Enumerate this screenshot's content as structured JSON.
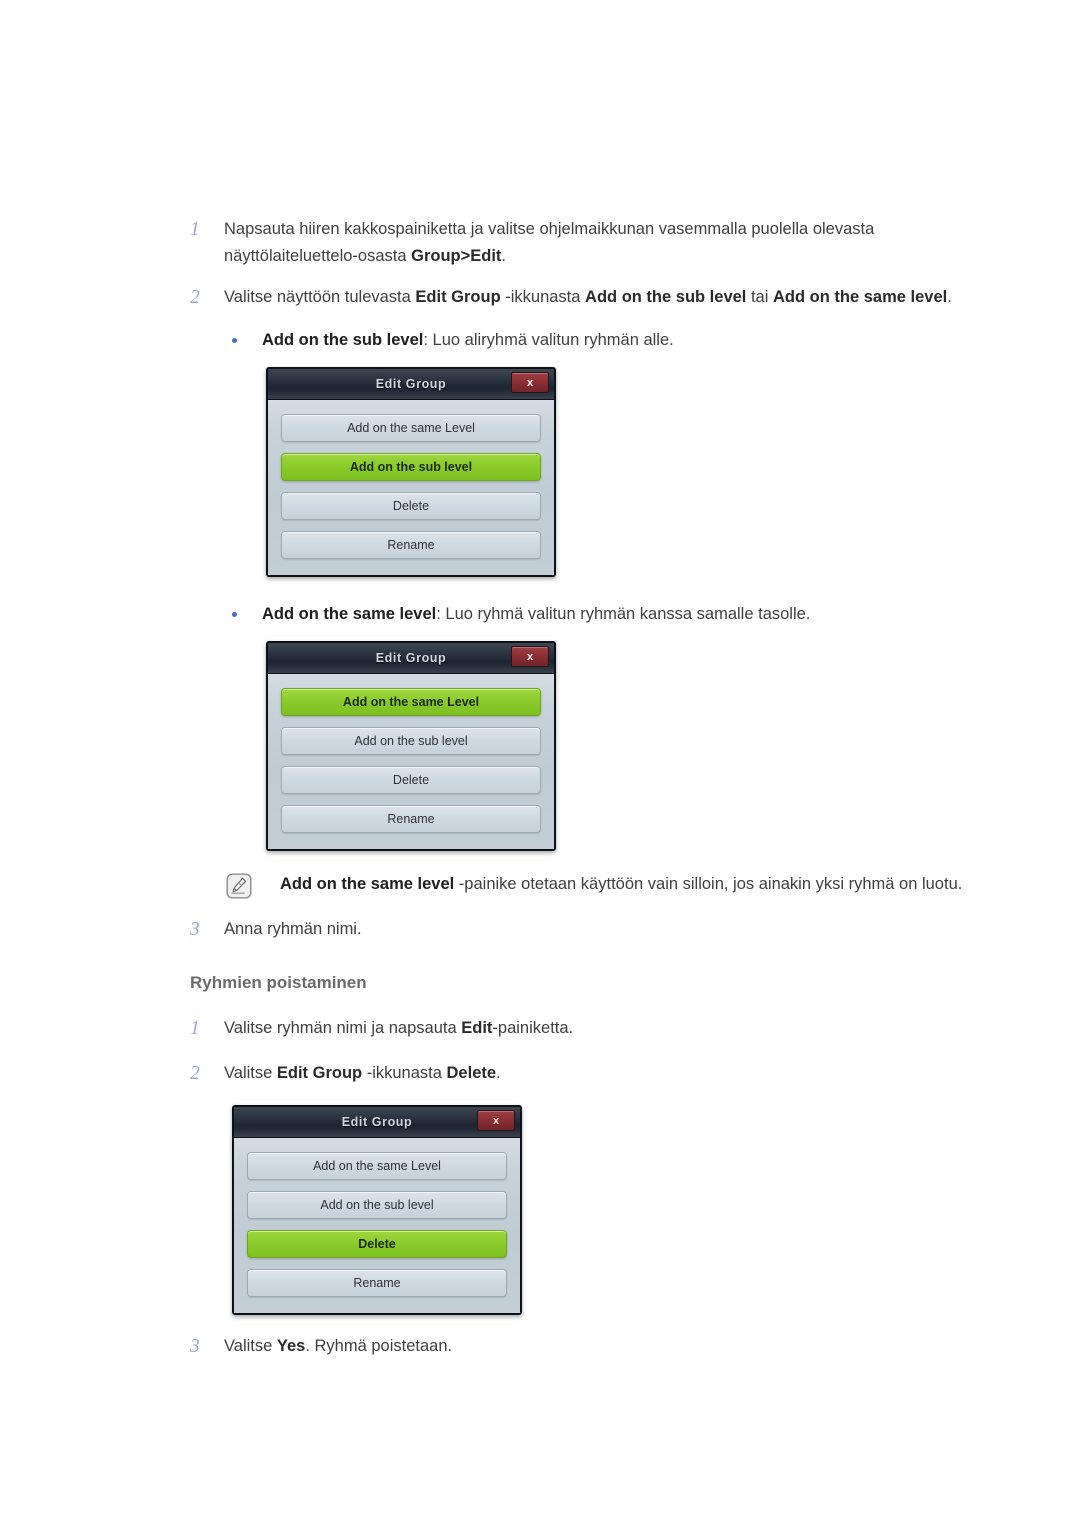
{
  "steps_group_add": [
    {
      "num": "1",
      "parts": [
        {
          "t": "Napsauta hiiren kakkospainiketta ja valitse ohjelmaikkunan vasemmalla puolella olevasta näyttölaiteluettelo-osasta ",
          "b": false
        },
        {
          "t": "Group>Edit",
          "b": true
        },
        {
          "t": ".",
          "b": false
        }
      ]
    },
    {
      "num": "2",
      "parts": [
        {
          "t": "Valitse näyttöön tulevasta ",
          "b": false
        },
        {
          "t": "Edit Group",
          "b": true
        },
        {
          "t": " -ikkunasta ",
          "b": false
        },
        {
          "t": "Add on the sub level",
          "b": true
        },
        {
          "t": " tai ",
          "b": false
        },
        {
          "t": "Add on the same level",
          "b": true
        },
        {
          "t": ".",
          "b": false
        }
      ]
    }
  ],
  "bullet_sub": [
    {
      "t": "Add on the sub level",
      "b": true
    },
    {
      "t": ": Luo aliryhmä valitun ryhmän alle.",
      "b": false
    }
  ],
  "bullet_same": [
    {
      "t": "Add on the same level",
      "b": true
    },
    {
      "t": ": Luo ryhmä valitun ryhmän kanssa samalle tasolle.",
      "b": false
    }
  ],
  "note": {
    "icon": "note-pencil-icon",
    "parts": [
      {
        "t": "Add on the same level",
        "b": true
      },
      {
        "t": " -painike otetaan käyttöön vain silloin, jos ainakin yksi ryhmä on luotu.",
        "b": false
      }
    ]
  },
  "step3_add": {
    "num": "3",
    "parts": [
      {
        "t": "Anna ryhmän nimi.",
        "b": false
      }
    ]
  },
  "section_delete_heading": "Ryhmien poistaminen",
  "steps_group_delete": [
    {
      "num": "1",
      "parts": [
        {
          "t": "Valitse ryhmän nimi ja napsauta ",
          "b": false
        },
        {
          "t": "Edit",
          "b": true
        },
        {
          "t": "-painiketta.",
          "b": false
        }
      ]
    },
    {
      "num": "2",
      "parts": [
        {
          "t": "Valitse ",
          "b": false
        },
        {
          "t": "Edit Group",
          "b": true
        },
        {
          "t": " -ikkunasta ",
          "b": false
        },
        {
          "t": "Delete",
          "b": true
        },
        {
          "t": ".",
          "b": false
        }
      ]
    }
  ],
  "step3_delete": {
    "num": "3",
    "parts": [
      {
        "t": "Valitse ",
        "b": false
      },
      {
        "t": "Yes",
        "b": true
      },
      {
        "t": ". Ryhmä poistetaan.",
        "b": false
      }
    ]
  },
  "dialogs": [
    {
      "title": "Edit Group",
      "close_label": "x",
      "buttons": [
        {
          "label": "Add on the same Level",
          "active": false
        },
        {
          "label": "Add on the sub level",
          "active": true
        },
        {
          "label": "Delete",
          "active": false
        },
        {
          "label": "Rename",
          "active": false
        }
      ]
    },
    {
      "title": "Edit Group",
      "close_label": "x",
      "buttons": [
        {
          "label": "Add on the same Level",
          "active": true
        },
        {
          "label": "Add on the sub level",
          "active": false
        },
        {
          "label": "Delete",
          "active": false
        },
        {
          "label": "Rename",
          "active": false
        }
      ]
    },
    {
      "title": "Edit Group",
      "close_label": "x",
      "buttons": [
        {
          "label": "Add on the same Level",
          "active": false
        },
        {
          "label": "Add on the sub level",
          "active": false
        },
        {
          "label": "Delete",
          "active": true
        },
        {
          "label": "Rename",
          "active": false
        }
      ]
    }
  ],
  "colors": {
    "step_number": "#9aa6dd",
    "bullet": "#4a6fbd",
    "heading": "#6b6b6b",
    "button_active": "#8ccc2c",
    "titlebar": "#1b2430",
    "close_button": "#8c3036",
    "dialog_body": "#c3ced6"
  }
}
